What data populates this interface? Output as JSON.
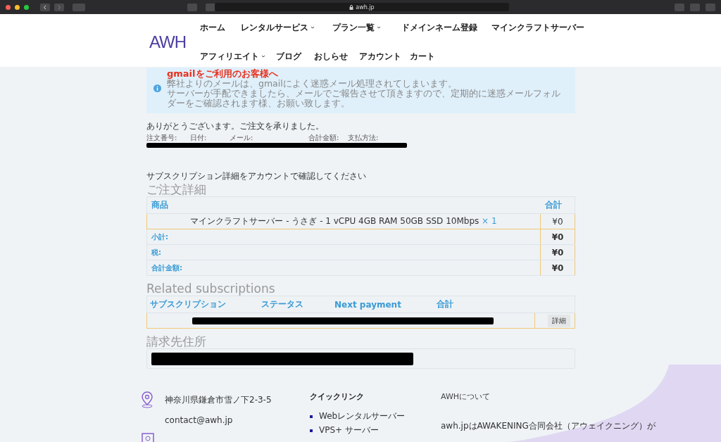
{
  "browser": {
    "url": "awh.jp"
  },
  "header": {
    "logo": "AWH",
    "nav_rows": [
      [
        {
          "label": "ホーム",
          "dropdown": false
        },
        {
          "label": "レンタルサービス",
          "dropdown": true
        },
        {
          "label": "プラン一覧",
          "dropdown": true
        },
        {
          "label": "ドメインネーム登録",
          "dropdown": false
        },
        {
          "label": "マインクラフトサーバー",
          "dropdown": false
        }
      ],
      [
        {
          "label": "アフィリエイト",
          "dropdown": true
        },
        {
          "label": "ブログ",
          "dropdown": false
        },
        {
          "label": "おしらせ",
          "dropdown": false
        },
        {
          "label": "アカウント",
          "dropdown": false
        },
        {
          "label": "カート",
          "dropdown": false
        }
      ]
    ]
  },
  "notice": {
    "title": "gmailをご利用のお客様へ",
    "lines": [
      "弊社よりのメールは、gmailによく迷惑メール処理されてしまいます。",
      "サーバーが手配できましたら、メールでご報告させて頂きますので、定期的に迷惑メールフォルダーをご確認されます様、お願い致します。"
    ]
  },
  "order_received": {
    "message": "ありがとうございます。ご注文を承りました。",
    "fields": [
      "注文番号:",
      "日付:",
      "メール:",
      "合計金額:",
      "支払方法:"
    ]
  },
  "subscription_note": "サブスクリプション詳細をアカウントで確認してください",
  "order_details": {
    "title": "ご注文詳細",
    "columns": [
      "商品",
      "合計"
    ],
    "items": [
      {
        "product": "マインクラフトサーバー - うさぎ - 1 vCPU 4GB RAM 50GB SSD 10Mbps",
        "quantity": "× 1",
        "total": "¥0"
      }
    ],
    "totals": [
      {
        "label": "小計:",
        "value": "¥0"
      },
      {
        "label": "税:",
        "value": "¥0"
      },
      {
        "label": "合計金額:",
        "value": "¥0"
      }
    ]
  },
  "related_subscriptions": {
    "title": "Related subscriptions",
    "columns": [
      "サブスクリプション",
      "ステータス",
      "Next payment",
      "合計"
    ],
    "rows": [
      {
        "action": "詳細"
      }
    ]
  },
  "billing_address": {
    "title": "請求先住所"
  },
  "footer": {
    "address": "神奈川県鎌倉市雪ノ下2-3-5",
    "email": "contact@awh.jp",
    "quick_links_title": "クイックリンク",
    "quick_links": [
      "Webレンタルサーバー",
      "VPS+ サーバー"
    ],
    "about_title": "AWHについて",
    "about_text": "awh.jpはAWAKENING合同会社（アウェイクニング）が"
  }
}
